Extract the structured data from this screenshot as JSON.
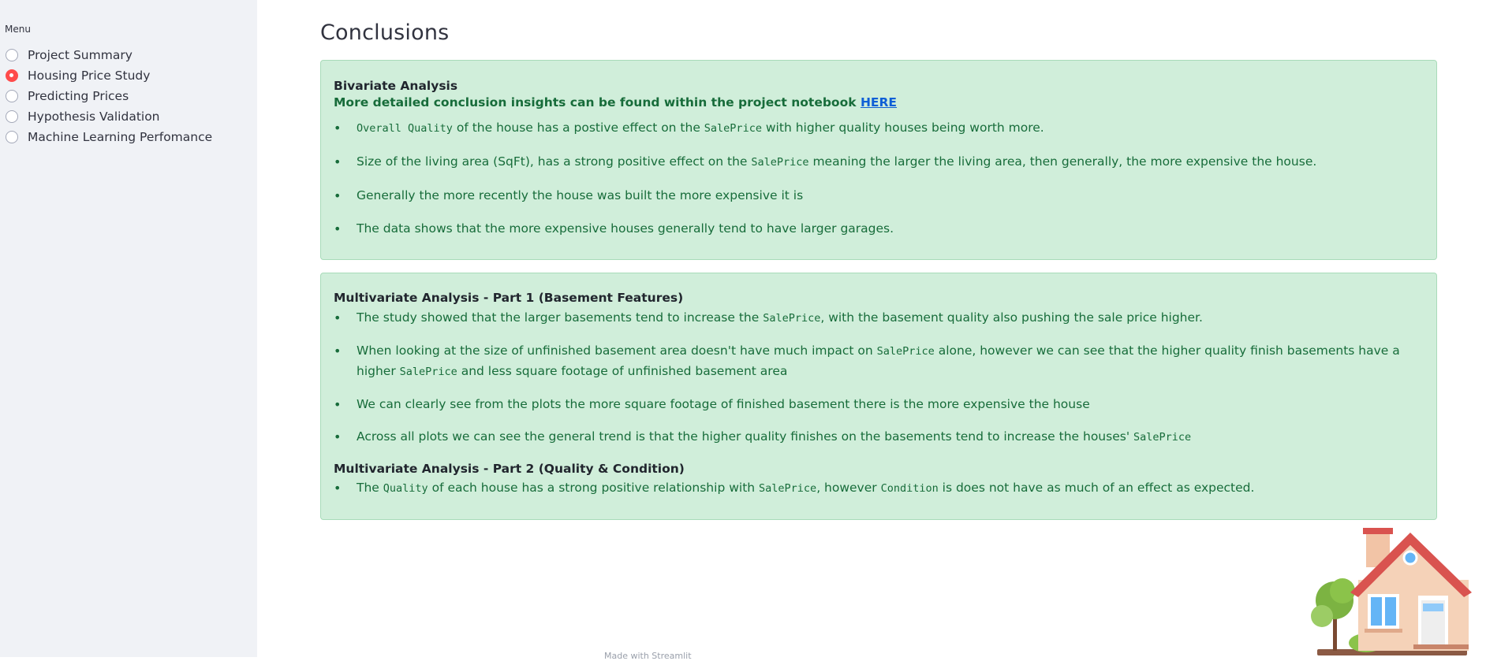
{
  "sidebar": {
    "title": "Menu",
    "items": [
      {
        "label": "Project Summary",
        "selected": false
      },
      {
        "label": "Housing Price Study",
        "selected": true
      },
      {
        "label": "Predicting Prices",
        "selected": false
      },
      {
        "label": "Hypothesis Validation",
        "selected": false
      },
      {
        "label": "Machine Learning Perfomance",
        "selected": false
      }
    ]
  },
  "main": {
    "title": "Conclusions",
    "bivariate": {
      "heading": "Bivariate Analysis",
      "subhead_text": "More detailed conclusion insights can be found within the project notebook ",
      "link_text": "HERE",
      "b1": {
        "code1": "Overall Quality",
        "t1": " of the house has a postive effect on the ",
        "code2": "SalePrice",
        "t2": " with higher quality houses being worth more."
      },
      "b2": {
        "t1": "Size of the living area (SqFt), has a strong positive effect on the ",
        "code1": "SalePrice",
        "t2": " meaning the larger the living area, then generally, the more expensive the house."
      },
      "b3": "Generally the more recently the house was built the more expensive it is",
      "b4": "The data shows that the more expensive houses generally tend to have larger garages."
    },
    "multivariate1": {
      "heading": "Multivariate Analysis - Part 1 (Basement Features)",
      "b1": {
        "t1": "The study showed that the larger basements tend to increase the ",
        "code1": "SalePrice",
        "t2": ", with the basement quality also pushing the sale price higher."
      },
      "b2": {
        "t1": "When looking at the size of unfinished basement area doesn't have much impact on ",
        "code1": "SalePrice",
        "t2": " alone, however we can see that the higher quality finish basements have a higher ",
        "code2": "SalePrice",
        "t3": " and less square footage of unfinished basement area"
      },
      "b3": "We can clearly see from the plots the more square footage of finished basement there is the more expensive the house",
      "b4": {
        "t1": "Across all plots we can see the general trend is that the higher quality finishes on the basements tend to increase the houses' ",
        "code1": "SalePrice"
      }
    },
    "multivariate2": {
      "heading": "Multivariate Analysis - Part 2 (Quality & Condition)",
      "b1": {
        "t1": "The ",
        "code1": "Quality",
        "t2": " of each house has a strong positive relationship with ",
        "code2": "SalePrice",
        "t3": ", however ",
        "code3": "Condition",
        "t4": " is does not have as much of an effect as expected."
      }
    }
  },
  "footer": {
    "text": "Made with Streamlit"
  },
  "colors": {
    "accent": "#ff4b4b",
    "success_bg": "#d0eeda",
    "success_text": "#176c3a",
    "sidebar_bg": "#f0f2f6"
  },
  "icons": {
    "house": "house-illustration"
  }
}
